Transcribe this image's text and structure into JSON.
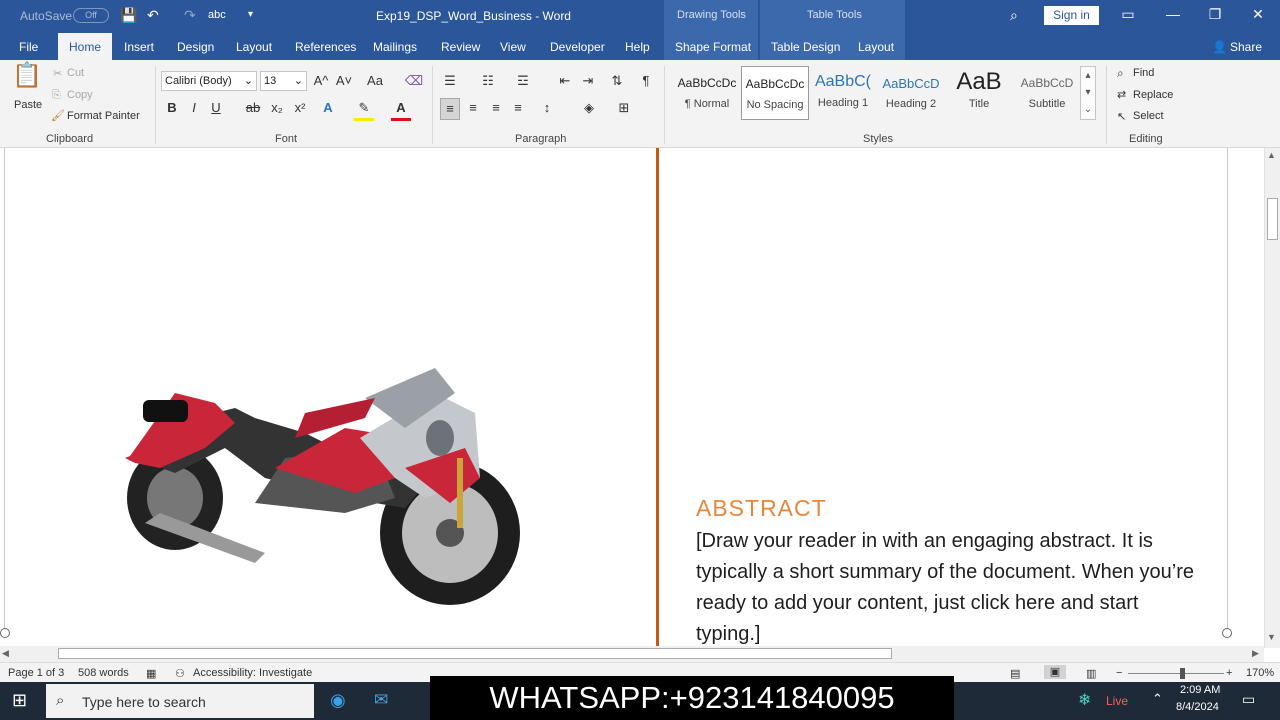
{
  "titlebar": {
    "autosave_label": "AutoSave",
    "autosave_state": "Off",
    "doc_title": "Exp19_DSP_Word_Business - Word",
    "ctx_drawing": "Drawing Tools",
    "ctx_table": "Table Tools",
    "signin_label": "Sign in"
  },
  "tabs": {
    "file": "File",
    "home": "Home",
    "insert": "Insert",
    "design": "Design",
    "layout": "Layout",
    "references": "References",
    "mailings": "Mailings",
    "review": "Review",
    "view": "View",
    "developer": "Developer",
    "help": "Help",
    "shape_format": "Shape Format",
    "table_design": "Table Design",
    "table_layout": "Layout",
    "share": "Share"
  },
  "ribbon": {
    "clipboard": {
      "paste": "Paste",
      "cut": "Cut",
      "copy": "Copy",
      "format_painter": "Format Painter",
      "label": "Clipboard"
    },
    "font": {
      "name": "Calibri (Body)",
      "size": "13",
      "label": "Font",
      "bold": "B",
      "italic": "I",
      "underline": "U",
      "strike": "ab",
      "sub": "x₂",
      "sup": "x²",
      "grow": "A^",
      "shrink": "A˅",
      "case": "Aa"
    },
    "paragraph": {
      "label": "Paragraph"
    },
    "styles": {
      "label": "Styles",
      "items": [
        {
          "preview": "AaBbCcDc",
          "name": "¶ Normal"
        },
        {
          "preview": "AaBbCcDc",
          "name": "No Spacing"
        },
        {
          "preview": "AaBbC(",
          "name": "Heading 1"
        },
        {
          "preview": "AaBbCcD",
          "name": "Heading 2"
        },
        {
          "preview": "AaB",
          "name": "Title"
        },
        {
          "preview": "AaBbCcD",
          "name": "Subtitle"
        }
      ]
    },
    "editing": {
      "find": "Find",
      "replace": "Replace",
      "select": "Select",
      "label": "Editing"
    }
  },
  "document": {
    "abstract_title": "ABSTRACT",
    "abstract_body": "[Draw your reader in with an engaging abstract. It is typically a short summary of the document. When you’re ready to add your content, just click here and start typing.]"
  },
  "status": {
    "page": "Page 1 of 3",
    "words": "508 words",
    "accessibility": "Accessibility: Investigate",
    "zoom": "170%"
  },
  "taskbar": {
    "search_placeholder": "Type here to search",
    "weather": "Live",
    "time": "2:09 AM",
    "date": "8/4/2024"
  },
  "overlay": {
    "text": "WHATSAPP:+923141840095"
  },
  "colors": {
    "word_blue": "#2b579a",
    "accent_orange": "#c55a11",
    "abstract_orange": "#e8873a"
  }
}
